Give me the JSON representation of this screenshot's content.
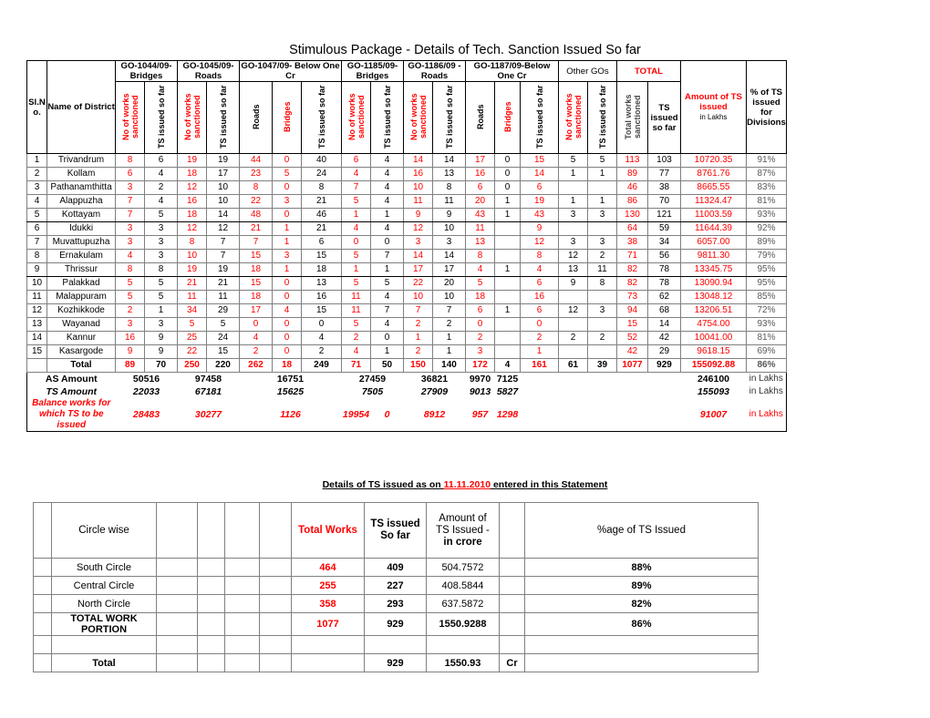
{
  "title": "Stimulous Package - Details of Tech. Sanction Issued So far",
  "main_table": {
    "group_headers": [
      {
        "label": "Sl.N o.",
        "kind": "stub"
      },
      {
        "label": "Name of District",
        "kind": "stub"
      },
      {
        "label": "GO-1044/09-Bridges",
        "color": "#000000"
      },
      {
        "label": "GO-1045/09-Roads",
        "color": "#000000"
      },
      {
        "label": "GO-1047/09- Below One Cr",
        "color": "#000000"
      },
      {
        "label": "GO-1185/09-Bridges",
        "color": "#000000"
      },
      {
        "label": "GO-1186/09 -Roads",
        "color": "#000000"
      },
      {
        "label": "GO-1187/09-Below One Cr",
        "color": "#000000"
      },
      {
        "label": "Other GOs",
        "color": "#000000"
      },
      {
        "label": "TOTAL",
        "color": "#ff0000"
      }
    ],
    "sub_headers": [
      {
        "label": "Sl.N o.",
        "color": "#000000",
        "rot": false
      },
      {
        "label": "Name of District",
        "color": "#000000",
        "rot": false
      },
      {
        "label": "No of works sanctioned",
        "color": "#ff0000",
        "rot": true
      },
      {
        "label": "TS issued so far",
        "color": "#000000",
        "rot": true
      },
      {
        "label": "No of works sanctioned",
        "color": "#ff0000",
        "rot": true
      },
      {
        "label": "TS issued so far",
        "color": "#000000",
        "rot": true
      },
      {
        "label": "Roads",
        "color": "#000000",
        "rot": true
      },
      {
        "label": "Bridges",
        "color": "#ff0000",
        "rot": true
      },
      {
        "label": "TS issued so far",
        "color": "#000000",
        "rot": true
      },
      {
        "label": "No of works sanctioned",
        "color": "#ff0000",
        "rot": true
      },
      {
        "label": "TS issued so far",
        "color": "#000000",
        "rot": true
      },
      {
        "label": "No of works sanctioned",
        "color": "#ff0000",
        "rot": true
      },
      {
        "label": "TS issued so far",
        "color": "#000000",
        "rot": true
      },
      {
        "label": "Roads",
        "color": "#000000",
        "rot": true
      },
      {
        "label": "Bridges",
        "color": "#ff0000",
        "rot": true
      },
      {
        "label": "TS issued so far",
        "color": "#000000",
        "rot": true
      },
      {
        "label": "No of works sanctioned",
        "color": "#ff0000",
        "rot": true
      },
      {
        "label": "TS issued so far",
        "color": "#000000",
        "rot": true
      },
      {
        "label": "Total works sanctioned",
        "color": "#595959",
        "rot": true
      },
      {
        "label": "TS issued so far",
        "color": "#000000",
        "rot": false
      },
      {
        "label": "Amount of TS issued",
        "sub": "in Lakhs",
        "color": "#ff0000",
        "rot": false
      },
      {
        "label": "% of TS issued for Divisions",
        "color": "#000000",
        "rot": false
      }
    ],
    "rows": [
      {
        "sl": "1",
        "district": "Trivandrum",
        "c": [
          "8",
          "6",
          "19",
          "19",
          "44",
          "0",
          "40",
          "6",
          "4",
          "14",
          "14",
          "17",
          "0",
          "15",
          "5",
          "5",
          "113",
          "103",
          "10720.35",
          "91%"
        ]
      },
      {
        "sl": "2",
        "district": "Kollam",
        "c": [
          "6",
          "4",
          "18",
          "17",
          "23",
          "5",
          "24",
          "4",
          "4",
          "16",
          "13",
          "16",
          "0",
          "14",
          "1",
          "1",
          "89",
          "77",
          "8761.76",
          "87%"
        ]
      },
      {
        "sl": "3",
        "district": "Pathanamthitta",
        "c": [
          "3",
          "2",
          "12",
          "10",
          "8",
          "0",
          "8",
          "7",
          "4",
          "10",
          "8",
          "6",
          "0",
          "6",
          "",
          "",
          "46",
          "38",
          "8665.55",
          "83%"
        ]
      },
      {
        "sl": "4",
        "district": "Alappuzha",
        "c": [
          "7",
          "4",
          "16",
          "10",
          "22",
          "3",
          "21",
          "5",
          "4",
          "11",
          "11",
          "20",
          "1",
          "19",
          "1",
          "1",
          "86",
          "70",
          "11324.47",
          "81%"
        ]
      },
      {
        "sl": "5",
        "district": "Kottayam",
        "c": [
          "7",
          "5",
          "18",
          "14",
          "48",
          "0",
          "46",
          "1",
          "1",
          "9",
          "9",
          "43",
          "1",
          "43",
          "3",
          "3",
          "130",
          "121",
          "11003.59",
          "93%"
        ]
      },
      {
        "sl": "6",
        "district": "Idukki",
        "c": [
          "3",
          "3",
          "12",
          "12",
          "21",
          "1",
          "21",
          "4",
          "4",
          "12",
          "10",
          "11",
          "",
          "9",
          "",
          "",
          "64",
          "59",
          "11644.39",
          "92%"
        ]
      },
      {
        "sl": "7",
        "district": "Muvattupuzha",
        "c": [
          "3",
          "3",
          "8",
          "7",
          "7",
          "1",
          "6",
          "0",
          "0",
          "3",
          "3",
          "13",
          "",
          "12",
          "3",
          "3",
          "38",
          "34",
          "6057.00",
          "89%"
        ]
      },
      {
        "sl": "8",
        "district": "Ernakulam",
        "c": [
          "4",
          "3",
          "10",
          "7",
          "15",
          "3",
          "15",
          "5",
          "7",
          "14",
          "14",
          "8",
          "",
          "8",
          "12",
          "2",
          "71",
          "56",
          "9811.30",
          "79%"
        ]
      },
      {
        "sl": "9",
        "district": "Thrissur",
        "c": [
          "8",
          "8",
          "19",
          "19",
          "18",
          "1",
          "18",
          "1",
          "1",
          "17",
          "17",
          "4",
          "1",
          "4",
          "13",
          "11",
          "82",
          "78",
          "13345.75",
          "95%"
        ]
      },
      {
        "sl": "10",
        "district": "Palakkad",
        "c": [
          "5",
          "5",
          "21",
          "21",
          "15",
          "0",
          "13",
          "5",
          "5",
          "22",
          "20",
          "5",
          "",
          "6",
          "9",
          "8",
          "82",
          "78",
          "13090.94",
          "95%"
        ]
      },
      {
        "sl": "11",
        "district": "Malappuram",
        "c": [
          "5",
          "5",
          "11",
          "11",
          "18",
          "0",
          "16",
          "11",
          "4",
          "10",
          "10",
          "18",
          "",
          "16",
          "",
          "",
          "73",
          "62",
          "13048.12",
          "85%"
        ]
      },
      {
        "sl": "12",
        "district": "Kozhikkode",
        "c": [
          "2",
          "1",
          "34",
          "29",
          "17",
          "4",
          "15",
          "11",
          "7",
          "7",
          "7",
          "6",
          "1",
          "6",
          "12",
          "3",
          "94",
          "68",
          "13206.51",
          "72%"
        ]
      },
      {
        "sl": "13",
        "district": "Wayanad",
        "c": [
          "3",
          "3",
          "5",
          "5",
          "0",
          "0",
          "0",
          "5",
          "4",
          "2",
          "2",
          "0",
          "",
          "0",
          "",
          "",
          "15",
          "14",
          "4754.00",
          "93%"
        ]
      },
      {
        "sl": "14",
        "district": "Kannur",
        "c": [
          "16",
          "9",
          "25",
          "24",
          "4",
          "0",
          "4",
          "2",
          "0",
          "1",
          "1",
          "2",
          "",
          "2",
          "2",
          "2",
          "52",
          "42",
          "10041.00",
          "81%"
        ]
      },
      {
        "sl": "15",
        "district": "Kasargode",
        "c": [
          "9",
          "9",
          "22",
          "15",
          "2",
          "0",
          "2",
          "4",
          "1",
          "2",
          "1",
          "3",
          "",
          "1",
          "",
          "",
          "42",
          "29",
          "9618.15",
          "69%"
        ]
      }
    ],
    "total_row": {
      "sl": "",
      "district": "Total",
      "c": [
        "89",
        "70",
        "250",
        "220",
        "262",
        "18",
        "249",
        "71",
        "50",
        "150",
        "140",
        "172",
        "4",
        "161",
        "61",
        "39",
        "1077",
        "929",
        "155092.88",
        "86%"
      ]
    },
    "summary": [
      {
        "label": "AS Amount",
        "style": "bold",
        "values": {
          "go1044": "50516",
          "go1045": "97458",
          "go1047": "16751",
          "go1185": "27459",
          "go1186": "36821",
          "go1187r": "9970",
          "go1187b": "7125",
          "total": "246100"
        },
        "unit": "in Lakhs"
      },
      {
        "label": "TS Amount",
        "style": "bold-italic",
        "values": {
          "go1044": "22033",
          "go1045": "67181",
          "go1047": "15625",
          "go1185": "7505",
          "go1186": "27909",
          "go1187r": "9013",
          "go1187b": "5827",
          "total": "155093"
        },
        "unit": "in Lakhs"
      },
      {
        "label": "Balance works  for which TS to be issued",
        "style": "bold-italic-red",
        "values": {
          "go1044": "28483",
          "go1045": "30277",
          "go1047": "1126",
          "go1185": "19954",
          "go1185b": "0",
          "go1186": "8912",
          "go1187r": "957",
          "go1187b": "1298",
          "total": "91007"
        },
        "unit": "in Lakhs"
      }
    ]
  },
  "caption": {
    "pre": "Details of TS issued as on ",
    "date": "11.11.2010",
    "post": " entered in this Statement"
  },
  "bottom_table": {
    "headers": [
      "",
      "Circle wise",
      "",
      "",
      "",
      "",
      "Total Works",
      "TS issued So far",
      "Amount of TS Issued - in crore",
      "",
      "%age of TS Issued"
    ],
    "rows": [
      {
        "name": "South Circle",
        "total_works": "464",
        "ts_issued": "409",
        "amount": "504.7572",
        "cr": "",
        "pct": "88%",
        "bold_name": false
      },
      {
        "name": "Central Circle",
        "total_works": "255",
        "ts_issued": "227",
        "amount": "408.5844",
        "cr": "",
        "pct": "89%",
        "bold_name": false
      },
      {
        "name": "North Circle",
        "total_works": "358",
        "ts_issued": "293",
        "amount": "637.5872",
        "cr": "",
        "pct": "82%",
        "bold_name": false
      },
      {
        "name": "TOTAL WORK PORTION",
        "total_works": "1077",
        "ts_issued": "929",
        "amount": "1550.9288",
        "cr": "",
        "pct": "86%",
        "bold_name": true
      },
      {
        "name": "",
        "total_works": "",
        "ts_issued": "",
        "amount": "",
        "cr": "",
        "pct": "",
        "bold_name": false
      },
      {
        "name": "Total",
        "total_works": "",
        "ts_issued": "929",
        "amount": "1550.93",
        "cr": "Cr",
        "pct": "",
        "bold_name": true
      }
    ]
  }
}
